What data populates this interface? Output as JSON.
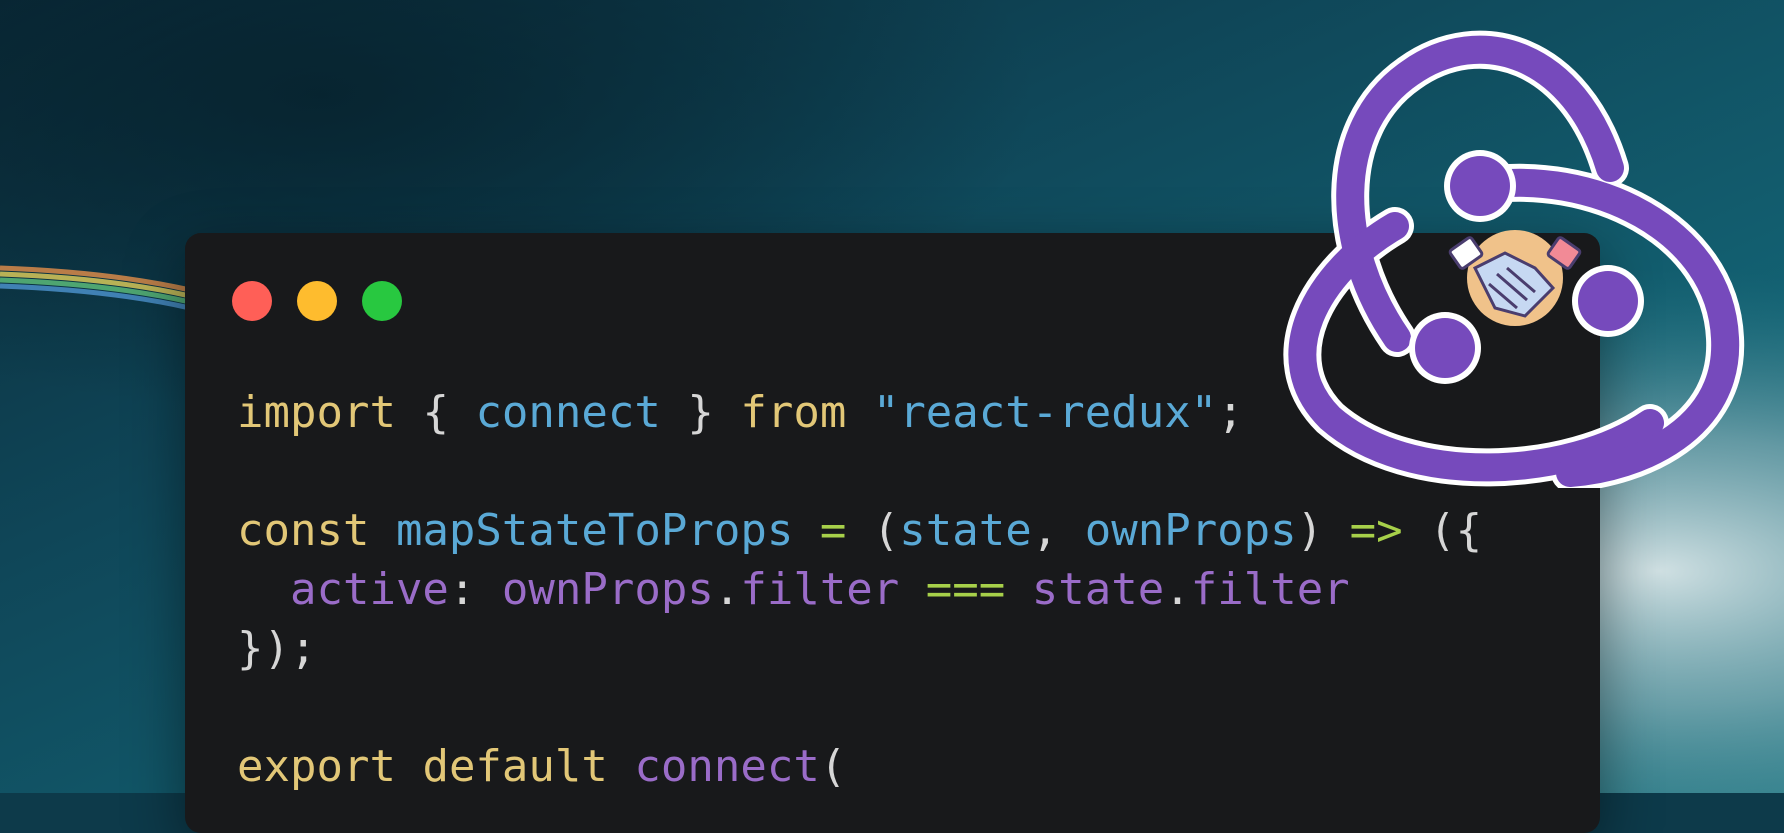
{
  "window": {
    "controls": [
      {
        "name": "close",
        "color": "#ff5f57"
      },
      {
        "name": "minimize",
        "color": "#febc2e"
      },
      {
        "name": "zoom",
        "color": "#28c840"
      }
    ]
  },
  "code": {
    "lines": [
      [
        {
          "t": "import",
          "c": "kw"
        },
        {
          "t": " { ",
          "c": "pn"
        },
        {
          "t": "connect",
          "c": "id"
        },
        {
          "t": " } ",
          "c": "pn"
        },
        {
          "t": "from",
          "c": "kw"
        },
        {
          "t": " ",
          "c": "pn"
        },
        {
          "t": "\"react-redux\"",
          "c": "str"
        },
        {
          "t": ";",
          "c": "pn"
        }
      ],
      [],
      [
        {
          "t": "const",
          "c": "kw"
        },
        {
          "t": " ",
          "c": "pn"
        },
        {
          "t": "mapStateToProps",
          "c": "id"
        },
        {
          "t": " ",
          "c": "pn"
        },
        {
          "t": "=",
          "c": "op"
        },
        {
          "t": " (",
          "c": "pn"
        },
        {
          "t": "state",
          "c": "id"
        },
        {
          "t": ", ",
          "c": "pn"
        },
        {
          "t": "ownProps",
          "c": "id"
        },
        {
          "t": ") ",
          "c": "pn"
        },
        {
          "t": "=>",
          "c": "op"
        },
        {
          "t": " ({",
          "c": "pn"
        }
      ],
      [
        {
          "t": "  ",
          "c": "pn"
        },
        {
          "t": "active",
          "c": "pr"
        },
        {
          "t": ": ",
          "c": "pn"
        },
        {
          "t": "ownProps",
          "c": "pr"
        },
        {
          "t": ".",
          "c": "pn"
        },
        {
          "t": "filter",
          "c": "pr"
        },
        {
          "t": " ",
          "c": "pn"
        },
        {
          "t": "===",
          "c": "op"
        },
        {
          "t": " ",
          "c": "pn"
        },
        {
          "t": "state",
          "c": "pr"
        },
        {
          "t": ".",
          "c": "pn"
        },
        {
          "t": "filter",
          "c": "pr"
        }
      ],
      [
        {
          "t": "});",
          "c": "pn"
        }
      ],
      [],
      [
        {
          "t": "export",
          "c": "kw"
        },
        {
          "t": " ",
          "c": "pn"
        },
        {
          "t": "default",
          "c": "kw"
        },
        {
          "t": " ",
          "c": "pn"
        },
        {
          "t": "connect",
          "c": "pr"
        },
        {
          "t": "(",
          "c": "pn"
        }
      ]
    ]
  },
  "logo": {
    "name": "redux-logo",
    "color": "#764abc",
    "badge": "handshake-icon"
  }
}
